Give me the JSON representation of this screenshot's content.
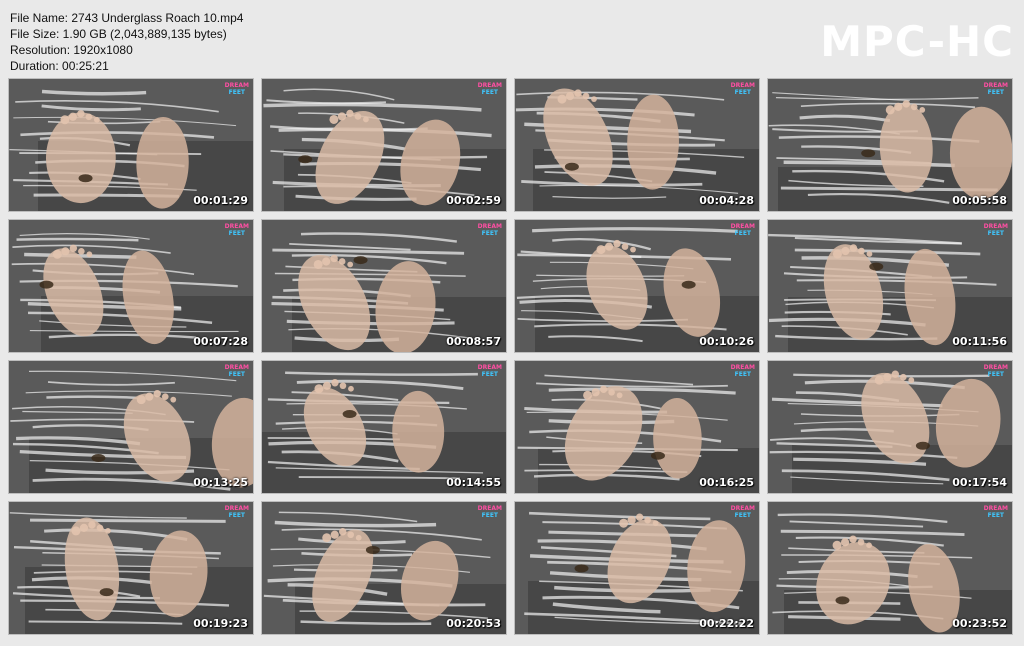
{
  "info": {
    "file_name": "File Name: 2743 Underglass Roach 10.mp4",
    "file_size": "File Size: 1.90 GB (2,043,889,135 bytes)",
    "resolution": "Resolution: 1920x1080",
    "duration": "Duration: 00:25:21"
  },
  "logo": "MPC-HC",
  "watermark": {
    "line1": "DREAM",
    "line2": "FEET"
  },
  "thumbnails": [
    "00:01:29",
    "00:02:59",
    "00:04:28",
    "00:05:58",
    "00:07:28",
    "00:08:57",
    "00:10:26",
    "00:11:56",
    "00:13:25",
    "00:14:55",
    "00:16:25",
    "00:17:54",
    "00:19:23",
    "00:20:53",
    "00:22:22",
    "00:23:52"
  ]
}
